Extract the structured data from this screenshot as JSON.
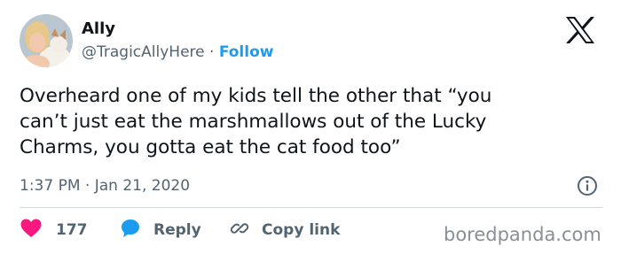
{
  "author": {
    "name": "Ally",
    "handle": "@TragicAllyHere",
    "separator": "·",
    "follow_label": "Follow"
  },
  "tweet": {
    "lines": [
      "Overheard one of my kids tell the other that “you",
      "can’t just eat the marshmallows out of the Lucky",
      "Charms, you gotta eat the cat food too”"
    ],
    "timestamp": "1:37 PM · Jan 21, 2020"
  },
  "actions": {
    "likes": "177",
    "reply_label": "Reply",
    "copy_label": "Copy link"
  },
  "watermark": "boredpanda.com",
  "colors": {
    "accent": "#1d9bf0",
    "like": "#f91880",
    "secondary_text": "#536471"
  },
  "icons": {
    "logo": "x-logo-icon",
    "info": "info-icon",
    "like": "heart-icon",
    "reply": "speech-bubble-icon",
    "copy": "link-icon"
  }
}
